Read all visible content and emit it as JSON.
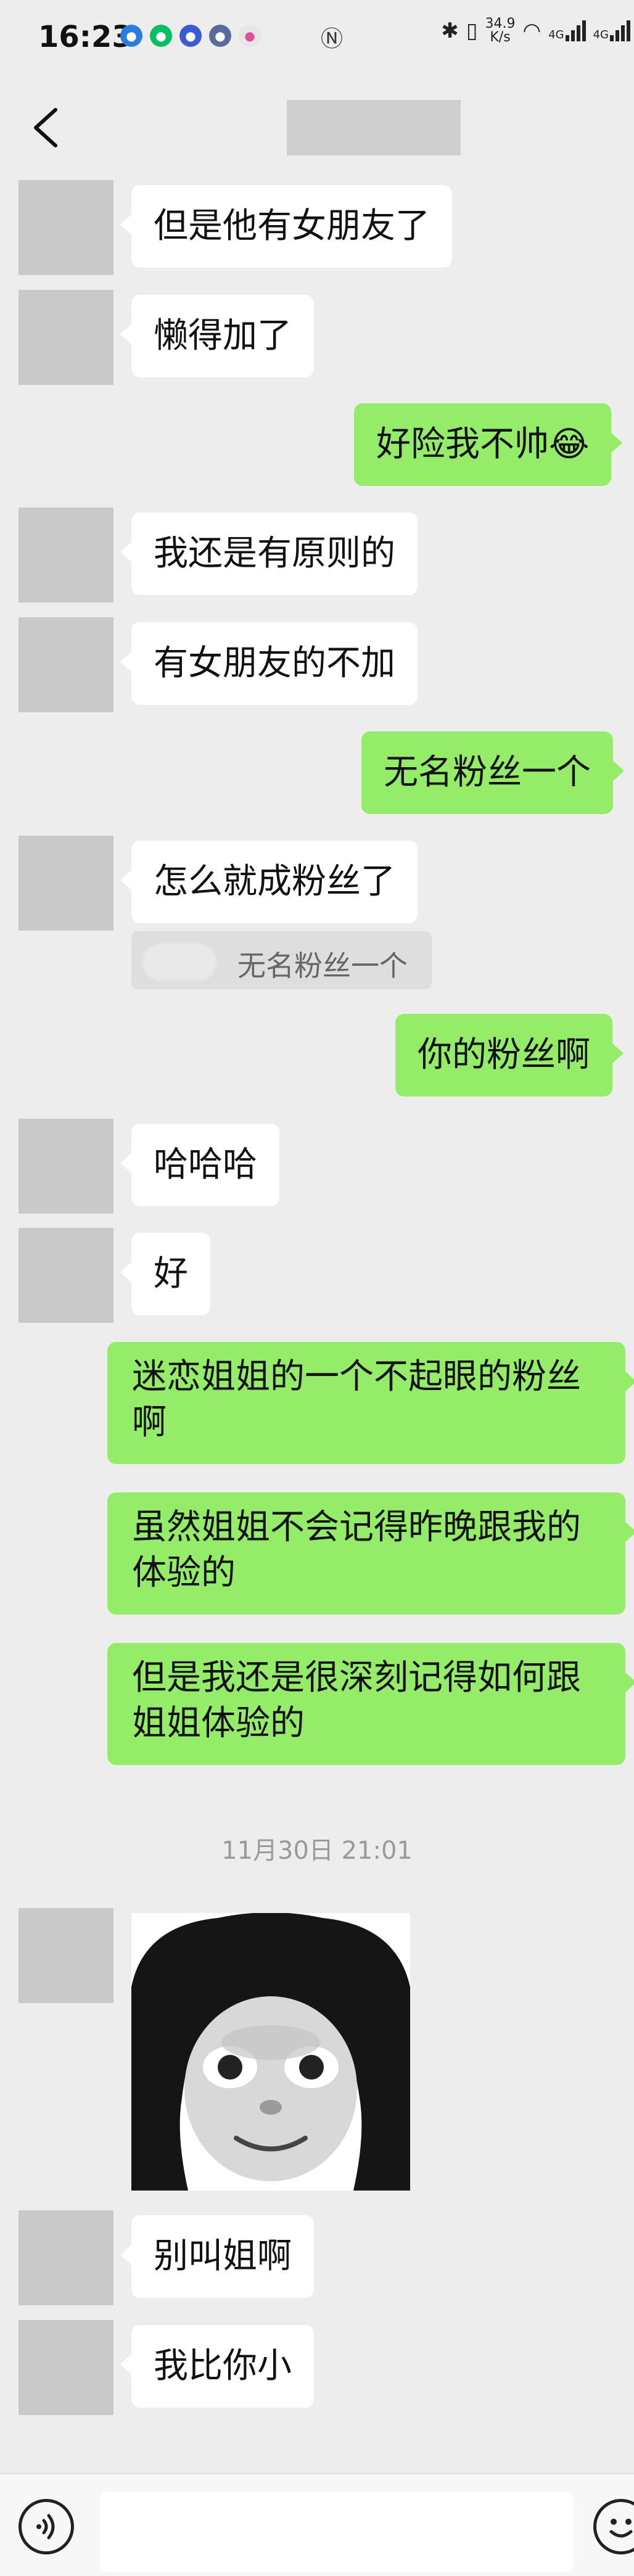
{
  "status_bar": {
    "time": "16:23",
    "network_speed_value": "34.9",
    "network_speed_unit": "K/s",
    "signal_1": "4G",
    "signal_2": "4G"
  },
  "chat": {
    "timestamp": "11月30日 21:01",
    "messages": [
      {
        "side": "left",
        "text": "但是他有女朋友了"
      },
      {
        "side": "left",
        "text": "懒得加了"
      },
      {
        "side": "right",
        "text": "好险我不帅😂"
      },
      {
        "side": "left",
        "text": "我还是有原则的"
      },
      {
        "side": "left",
        "text": "有女朋友的不加"
      },
      {
        "side": "right",
        "text": "无名粉丝一个"
      },
      {
        "side": "left",
        "text": "怎么就成粉丝了",
        "quote": "无名粉丝一个"
      },
      {
        "side": "right",
        "text": "你的粉丝啊"
      },
      {
        "side": "left",
        "text": "哈哈哈"
      },
      {
        "side": "left",
        "text": "好"
      },
      {
        "side": "right",
        "text": "迷恋姐姐的一个不起眼的粉丝啊"
      },
      {
        "side": "right",
        "text": "虽然姐姐不会记得昨晚跟我的体验的"
      },
      {
        "side": "right",
        "text": "但是我还是很深刻记得如何跟姐姐体验的"
      },
      {
        "side": "left",
        "text": "别叫姐啊"
      },
      {
        "side": "left",
        "text": "我比你小"
      }
    ]
  },
  "colors": {
    "background": "#ededed",
    "bubble_self": "#95ec69",
    "bubble_other": "#ffffff",
    "avatar_placeholder": "#c9c9c9"
  },
  "icons": [
    "back-arrow-icon",
    "voice-icon",
    "emoji-icon",
    "bluetooth-icon",
    "vibrate-icon",
    "wifi-icon",
    "nfc-icon"
  ]
}
